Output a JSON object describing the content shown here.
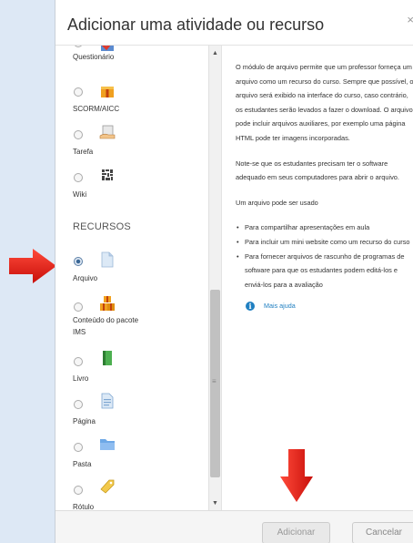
{
  "dialog": {
    "title": "Adicionar uma atividade ou recurso",
    "close": "×"
  },
  "activities": [
    {
      "label": "Questionário",
      "icon": "quiz-checkmark-icon"
    },
    {
      "label": "SCORM/AICC",
      "icon": "scorm-package-icon"
    },
    {
      "label": "Tarefa",
      "icon": "assignment-hand-icon"
    },
    {
      "label": "Wiki",
      "icon": "wiki-icon"
    }
  ],
  "resources_heading": "RECURSOS",
  "resources": [
    {
      "label": "Arquivo",
      "icon": "file-icon",
      "selected": true
    },
    {
      "label": "Conteúdo do pacote IMS",
      "icon": "ims-package-icon",
      "selected": false
    },
    {
      "label": "Livro",
      "icon": "book-icon",
      "selected": false
    },
    {
      "label": "Página",
      "icon": "page-icon",
      "selected": false
    },
    {
      "label": "Pasta",
      "icon": "folder-icon",
      "selected": false
    },
    {
      "label": "Rótulo",
      "icon": "label-tag-icon",
      "selected": false
    }
  ],
  "description": {
    "p1": "O módulo de arquivo permite que um professor forneça um arquivo como um recurso do curso. Sempre que possível, o arquivo será exibido na interface do curso, caso contrário, os estudantes serão levados a fazer o download. O arquivo pode incluir arquivos auxiliares, por exemplo uma página HTML pode ter imagens incorporadas.",
    "p2": "Note-se que os estudantes precisam ter o software adequado em seus computadores para abrir o arquivo.",
    "p3": "Um arquivo pode ser usado",
    "bullets": [
      "Para compartilhar apresentações em aula",
      "Para incluir um mini website como um recurso do curso",
      "Para fornecer arquivos de rascunho de programas de software para que os estudantes podem editá-los e enviá-los para a avaliação"
    ],
    "help_link": "Mais ajuda",
    "info_glyph": "i"
  },
  "footer": {
    "add_label": "Adicionar",
    "cancel_label": "Cancelar"
  },
  "colors": {
    "annotation_arrow": "#e8231b",
    "link": "#1f7fc1"
  }
}
